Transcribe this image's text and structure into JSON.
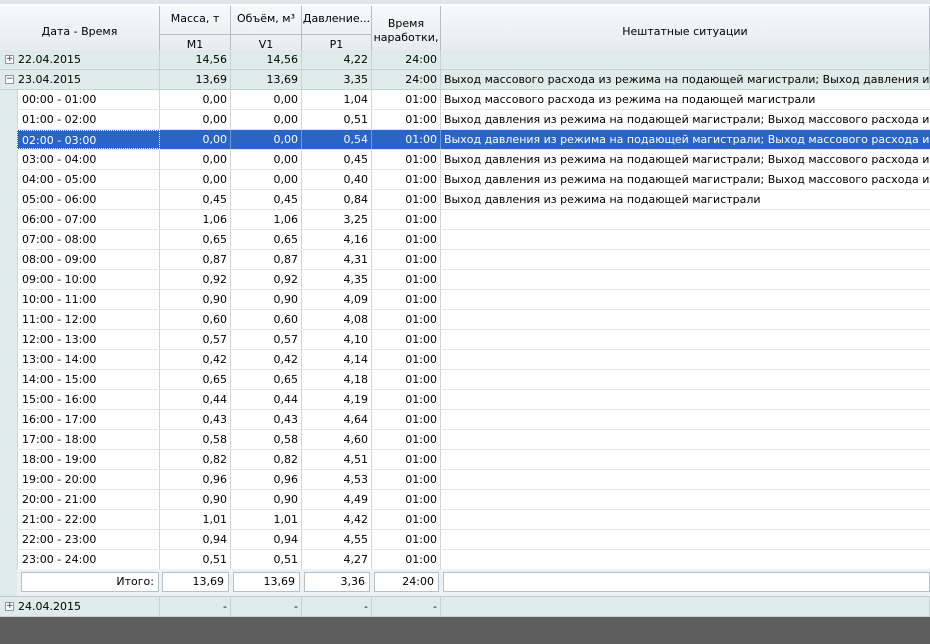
{
  "header": {
    "datetime": "Дата - Время",
    "mass": "Масса, т",
    "mass_sub": "M1",
    "volume": "Объём, м³",
    "volume_sub": "V1",
    "pressure": "Давление...",
    "pressure_sub": "P1",
    "runtime": "Время наработки,",
    "events": "Нештатные ситуации"
  },
  "group1": {
    "label": "22.04.2015",
    "mass": "14,56",
    "volume": "14,56",
    "pressure": "4,22",
    "runtime": "24:00",
    "events": ""
  },
  "group2": {
    "label": "23.04.2015",
    "mass": "13,69",
    "volume": "13,69",
    "pressure": "3,35",
    "runtime": "24:00",
    "events": "Выход массового расхода из режима на подающей магистрали; Выход давления из режима на п"
  },
  "rows": [
    {
      "time": "00:00 - 01:00",
      "mass": "0,00",
      "volume": "0,00",
      "pressure": "1,04",
      "runtime": "01:00",
      "events": "Выход массового расхода из режима на подающей магистрали"
    },
    {
      "time": "01:00 - 02:00",
      "mass": "0,00",
      "volume": "0,00",
      "pressure": "0,51",
      "runtime": "01:00",
      "events": "Выход давления из режима на подающей магистрали; Выход массового расхода из режима на"
    },
    {
      "time": "02:00 - 03:00",
      "mass": "0,00",
      "volume": "0,00",
      "pressure": "0,54",
      "runtime": "01:00",
      "events": "Выход давления из режима на подающей магистрали; Выход массового расхода из режима на"
    },
    {
      "time": "03:00 - 04:00",
      "mass": "0,00",
      "volume": "0,00",
      "pressure": "0,45",
      "runtime": "01:00",
      "events": "Выход давления из режима на подающей магистрали; Выход массового расхода из режима на"
    },
    {
      "time": "04:00 - 05:00",
      "mass": "0,00",
      "volume": "0,00",
      "pressure": "0,40",
      "runtime": "01:00",
      "events": "Выход давления из режима на подающей магистрали; Выход массового расхода из режима на"
    },
    {
      "time": "05:00 - 06:00",
      "mass": "0,45",
      "volume": "0,45",
      "pressure": "0,84",
      "runtime": "01:00",
      "events": "Выход давления из режима на подающей магистрали"
    },
    {
      "time": "06:00 - 07:00",
      "mass": "1,06",
      "volume": "1,06",
      "pressure": "3,25",
      "runtime": "01:00",
      "events": ""
    },
    {
      "time": "07:00 - 08:00",
      "mass": "0,65",
      "volume": "0,65",
      "pressure": "4,16",
      "runtime": "01:00",
      "events": ""
    },
    {
      "time": "08:00 - 09:00",
      "mass": "0,87",
      "volume": "0,87",
      "pressure": "4,31",
      "runtime": "01:00",
      "events": ""
    },
    {
      "time": "09:00 - 10:00",
      "mass": "0,92",
      "volume": "0,92",
      "pressure": "4,35",
      "runtime": "01:00",
      "events": ""
    },
    {
      "time": "10:00 - 11:00",
      "mass": "0,90",
      "volume": "0,90",
      "pressure": "4,09",
      "runtime": "01:00",
      "events": ""
    },
    {
      "time": "11:00 - 12:00",
      "mass": "0,60",
      "volume": "0,60",
      "pressure": "4,08",
      "runtime": "01:00",
      "events": ""
    },
    {
      "time": "12:00 - 13:00",
      "mass": "0,57",
      "volume": "0,57",
      "pressure": "4,10",
      "runtime": "01:00",
      "events": ""
    },
    {
      "time": "13:00 - 14:00",
      "mass": "0,42",
      "volume": "0,42",
      "pressure": "4,14",
      "runtime": "01:00",
      "events": ""
    },
    {
      "time": "14:00 - 15:00",
      "mass": "0,65",
      "volume": "0,65",
      "pressure": "4,18",
      "runtime": "01:00",
      "events": ""
    },
    {
      "time": "15:00 - 16:00",
      "mass": "0,44",
      "volume": "0,44",
      "pressure": "4,19",
      "runtime": "01:00",
      "events": ""
    },
    {
      "time": "16:00 - 17:00",
      "mass": "0,43",
      "volume": "0,43",
      "pressure": "4,64",
      "runtime": "01:00",
      "events": ""
    },
    {
      "time": "17:00 - 18:00",
      "mass": "0,58",
      "volume": "0,58",
      "pressure": "4,60",
      "runtime": "01:00",
      "events": ""
    },
    {
      "time": "18:00 - 19:00",
      "mass": "0,82",
      "volume": "0,82",
      "pressure": "4,51",
      "runtime": "01:00",
      "events": ""
    },
    {
      "time": "19:00 - 20:00",
      "mass": "0,96",
      "volume": "0,96",
      "pressure": "4,53",
      "runtime": "01:00",
      "events": ""
    },
    {
      "time": "20:00 - 21:00",
      "mass": "0,90",
      "volume": "0,90",
      "pressure": "4,49",
      "runtime": "01:00",
      "events": ""
    },
    {
      "time": "21:00 - 22:00",
      "mass": "1,01",
      "volume": "1,01",
      "pressure": "4,42",
      "runtime": "01:00",
      "events": ""
    },
    {
      "time": "22:00 - 23:00",
      "mass": "0,94",
      "volume": "0,94",
      "pressure": "4,55",
      "runtime": "01:00",
      "events": ""
    },
    {
      "time": "23:00 - 24:00",
      "mass": "0,51",
      "volume": "0,51",
      "pressure": "4,27",
      "runtime": "01:00",
      "events": ""
    }
  ],
  "selected_row_index": 2,
  "footer": {
    "label": "Итого:",
    "mass": "13,69",
    "volume": "13,69",
    "pressure": "3,36",
    "runtime": "24:00"
  },
  "group3": {
    "label": "24.04.2015",
    "mass": "-",
    "volume": "-",
    "pressure": "-",
    "runtime": "-"
  },
  "icons": {
    "expand": "plus-box-icon",
    "collapse": "minus-box-icon"
  },
  "colors": {
    "selection": "#2a64c6",
    "group_bg": "#dfebe8"
  }
}
